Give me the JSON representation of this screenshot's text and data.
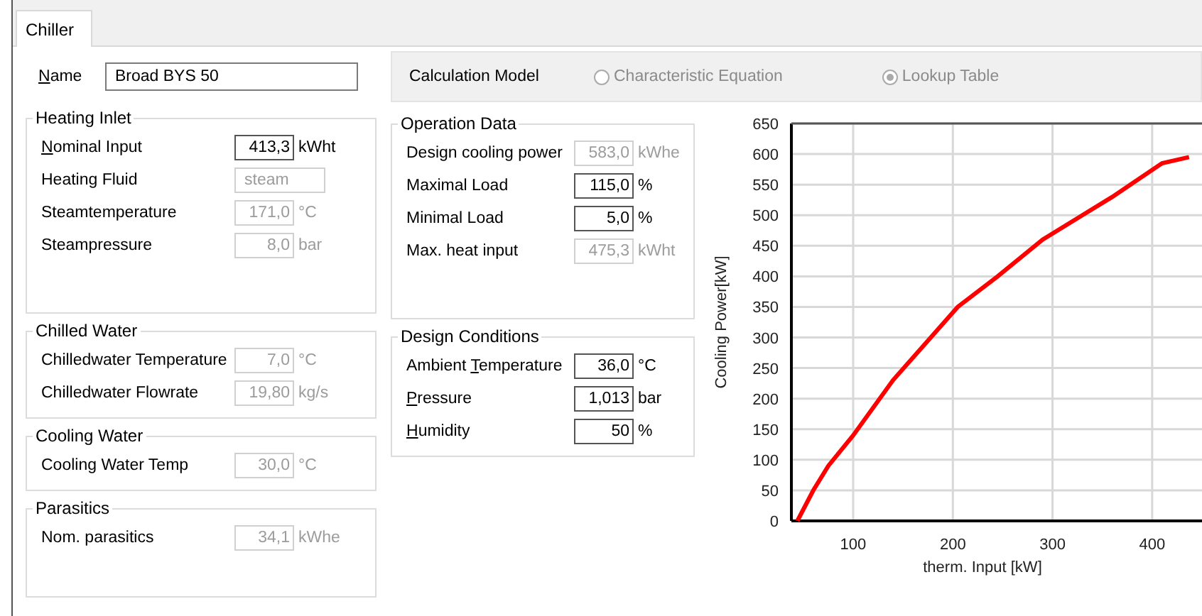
{
  "tab": {
    "label": "Chiller",
    "selected": true
  },
  "name": {
    "access_key": "N",
    "label_after": "ame",
    "value": "Broad BYS 50"
  },
  "calculation_model": {
    "label": "Calculation Model",
    "disabled": true,
    "options": [
      {
        "label": "Characteristic Equation",
        "selected": false
      },
      {
        "label": "Lookup Table",
        "selected": true
      }
    ]
  },
  "left_groups": [
    {
      "title": "Heating Inlet",
      "rows": [
        {
          "access_key": "N",
          "label_after": "ominal Input",
          "value": "413,3",
          "unit": "kWht",
          "disabled": false,
          "kind": "number"
        },
        {
          "label": "Heating Fluid",
          "value": "steam",
          "disabled": true,
          "kind": "text"
        },
        {
          "label": "Steamtemperature",
          "value": "171,0",
          "unit": "°C",
          "disabled": true,
          "kind": "number"
        },
        {
          "label": "Steampressure",
          "value": "8,0",
          "unit": "bar",
          "disabled": true,
          "kind": "number"
        }
      ]
    },
    {
      "title": "Chilled Water",
      "rows": [
        {
          "label": "Chilledwater Temperature",
          "value": "7,0",
          "unit": "°C",
          "disabled": true,
          "kind": "number"
        },
        {
          "label": "Chilledwater Flowrate",
          "value": "19,80",
          "unit": "kg/s",
          "disabled": true,
          "kind": "number"
        }
      ]
    },
    {
      "title": "Cooling Water",
      "rows": [
        {
          "label": "Cooling Water Temp",
          "value": "30,0",
          "unit": "°C",
          "disabled": true,
          "kind": "number"
        }
      ]
    },
    {
      "title": "Parasitics",
      "rows": [
        {
          "label": "Nom. parasitics",
          "value": "34,1",
          "unit": "kWhe",
          "disabled": true,
          "kind": "number"
        }
      ]
    }
  ],
  "right_groups": [
    {
      "title": "Operation Data",
      "rows": [
        {
          "label": "Design cooling power",
          "value": "583,0",
          "unit": "kWhe",
          "disabled": true,
          "kind": "number"
        },
        {
          "label": "Maximal Load",
          "value": "115,0",
          "unit": "%",
          "disabled": false,
          "kind": "number"
        },
        {
          "label": "Minimal Load",
          "value": "5,0",
          "unit": "%",
          "disabled": false,
          "kind": "number"
        },
        {
          "label": "Max. heat input",
          "value": "475,3",
          "unit": "kWht",
          "disabled": true,
          "kind": "number"
        }
      ]
    },
    {
      "title": "Design Conditions",
      "rows": [
        {
          "label": "Ambient ",
          "access_key": "T",
          "label_after": "emperature",
          "value": "36,0",
          "unit": "°C",
          "disabled": false,
          "kind": "number"
        },
        {
          "access_key": "P",
          "label_after": "ressure",
          "value": "1,013",
          "unit": "bar",
          "disabled": false,
          "kind": "number"
        },
        {
          "access_key": "H",
          "label_after": "umidity",
          "value": "50",
          "unit": "%",
          "disabled": false,
          "kind": "number"
        }
      ]
    }
  ],
  "chart": {
    "chart_data": {
      "type": "line",
      "grid": true,
      "xlabel": "therm. Input [kW]",
      "ylabel": "Cooling Power[kW]",
      "xlim": [
        38,
        450
      ],
      "ylim": [
        0,
        650
      ],
      "xticks": [
        100,
        200,
        300,
        400
      ],
      "yticks": [
        0,
        50,
        100,
        150,
        200,
        250,
        300,
        350,
        400,
        450,
        500,
        550,
        600,
        650
      ],
      "series": [
        {
          "color": "#ff0000",
          "x": [
            44,
            60,
            75,
            100,
            140,
            205,
            245,
            290,
            330,
            360,
            410,
            437
          ],
          "values": [
            0,
            50,
            90,
            140,
            230,
            350,
            400,
            460,
            500,
            530,
            585,
            595
          ]
        }
      ]
    }
  }
}
